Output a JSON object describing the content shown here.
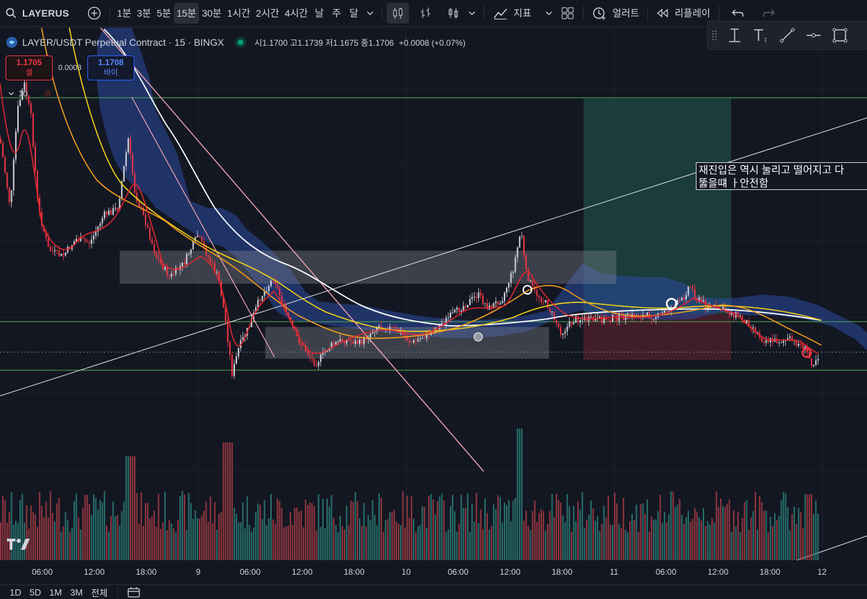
{
  "toolbar": {
    "symbol": "LAYERUS",
    "intervals": [
      "1분",
      "3분",
      "5분",
      "15분",
      "30분",
      "1시간",
      "2시간",
      "4시간",
      "날",
      "주",
      "달"
    ],
    "active_interval": "15분",
    "indicators_label": "지표",
    "alert_label": "얼러트",
    "replay_label": "리플레이"
  },
  "legend": {
    "title": "LAYER/USDT Perpetual Contract · 15 · BINGX",
    "open_label": "시",
    "open": "1.1700",
    "high_label": "고",
    "high": "1.1739",
    "low_label": "저",
    "low": "1.1675",
    "close_label": "종",
    "close": "1.1706",
    "change": "+0.0008 (+0.07%)"
  },
  "trade": {
    "sell_price": "1.1705",
    "sell_label": "셀",
    "buy_price": "1.1708",
    "buy_label": "바이",
    "spread": "0.0003",
    "quantity": "10"
  },
  "annotation": {
    "line1": "재진입은 역시 눌리고 떨어지고 다",
    "line2": "뚫을떄 ㅏ안전함"
  },
  "time_axis": {
    "labels": [
      "06:00",
      "12:00",
      "18:00",
      "9",
      "06:00",
      "12:00",
      "18:00",
      "10",
      "06:00",
      "12:00",
      "18:00",
      "11",
      "06:00",
      "12:00",
      "18:00",
      "12"
    ]
  },
  "bottombar": {
    "ranges": [
      "1D",
      "5D",
      "1M",
      "3M",
      "전체"
    ]
  },
  "colors": {
    "background": "#131722",
    "up": "#d1d4dc",
    "down": "#f23645",
    "ema_red": "#e0262f",
    "ema_orange": "#f59d1c",
    "ema_yellow": "#f5d316",
    "ma_white": "#ffffff",
    "cloud": "#2c4aa0",
    "horizontal_line": "#4caf50",
    "trendline_pink": "#f4a5b2"
  },
  "icons": [
    "search-icon",
    "add-symbol-icon",
    "chevron-down-icon",
    "candles-icon",
    "bars-icon",
    "line-chart-icon",
    "indicators-icon",
    "templates-icon",
    "alert-icon",
    "replay-icon",
    "undo-icon",
    "redo-icon",
    "crosshair-icon",
    "text-icon",
    "trendline-icon",
    "horizontal-ray-icon",
    "rectangle-icon",
    "calendar-icon"
  ]
}
